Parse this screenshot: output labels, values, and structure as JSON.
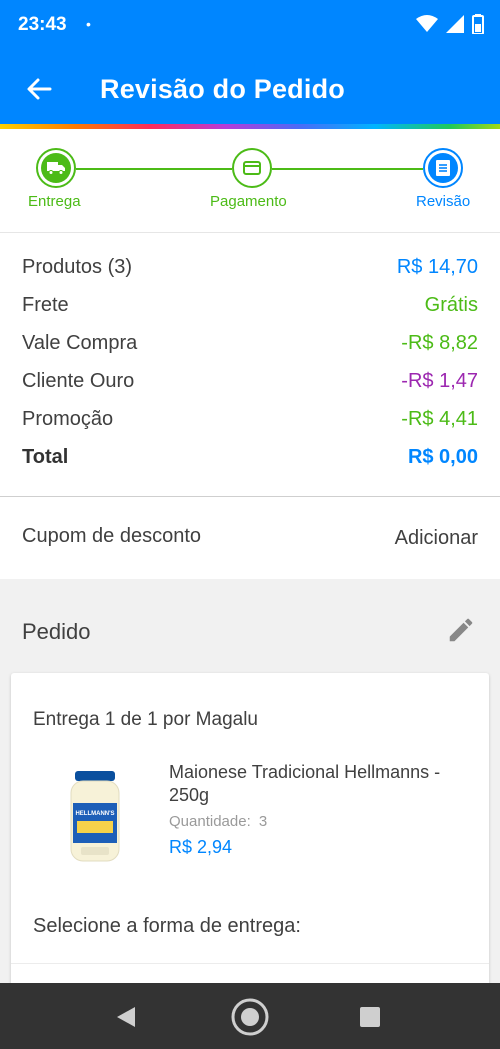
{
  "status_bar": {
    "time": "23:43",
    "dot": "•"
  },
  "app_bar": {
    "title": "Revisão do Pedido"
  },
  "stepper": {
    "steps": [
      {
        "label": "Entrega",
        "icon": "truck-icon"
      },
      {
        "label": "Pagamento",
        "icon": "card-icon"
      },
      {
        "label": "Revisão",
        "icon": "list-icon"
      }
    ]
  },
  "summary": {
    "rows": [
      {
        "label": "Produtos (3)",
        "value": "R$ 14,70"
      },
      {
        "label": "Frete",
        "value": "Grátis"
      },
      {
        "label": "Vale Compra",
        "value": "-R$ 8,82"
      },
      {
        "label": "Cliente Ouro",
        "value": "-R$ 1,47"
      },
      {
        "label": "Promoção",
        "value": "-R$ 4,41"
      },
      {
        "label": "Total",
        "value": "R$ 0,00"
      }
    ]
  },
  "coupon": {
    "label": "Cupom de desconto",
    "action": "Adicionar"
  },
  "order": {
    "title": "Pedido",
    "shipment_title": "Entrega 1 de 1 por Magalu",
    "product": {
      "name": "Maionese Tradicional Hellmanns - 250g",
      "quantity_label": "Quantidade:",
      "quantity": "3",
      "price": "R$ 2,94",
      "image_brand": "HELLMANN'S"
    },
    "delivery_label": "Selecione a forma de entrega:"
  },
  "colors": {
    "primary": "#0086ff",
    "green": "#4cbb17",
    "purple": "#9c27b0",
    "nav_bar": "#333333"
  }
}
